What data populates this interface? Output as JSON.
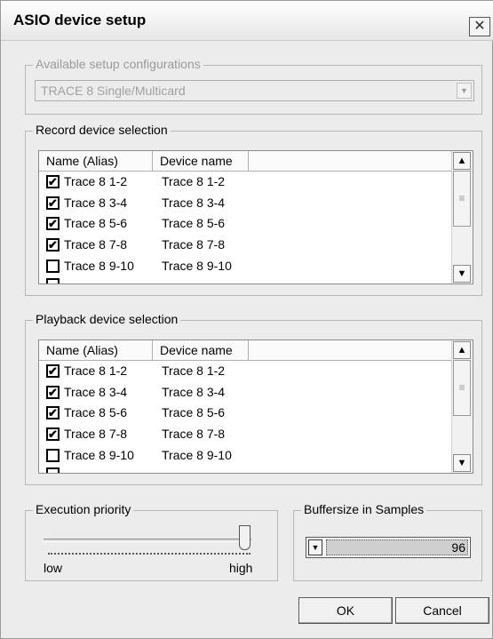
{
  "window": {
    "title": "ASIO device setup",
    "close_glyph": "✕"
  },
  "setup_configurations": {
    "legend": "Available setup configurations",
    "selected": "TRACE 8 Single/Multicard"
  },
  "record": {
    "legend": "Record device selection",
    "columns": [
      "Name (Alias)",
      "Device name"
    ],
    "rows": [
      {
        "alias": "Trace 8 1-2",
        "device": "Trace 8 1-2",
        "checked": true
      },
      {
        "alias": "Trace 8 3-4",
        "device": "Trace 8 3-4",
        "checked": true
      },
      {
        "alias": "Trace 8 5-6",
        "device": "Trace 8 5-6",
        "checked": true
      },
      {
        "alias": "Trace 8 7-8",
        "device": "Trace 8 7-8",
        "checked": true
      },
      {
        "alias": "Trace 8 9-10",
        "device": "Trace 8 9-10",
        "checked": false
      }
    ]
  },
  "playback": {
    "legend": "Playback device selection",
    "columns": [
      "Name (Alias)",
      "Device name"
    ],
    "rows": [
      {
        "alias": "Trace 8 1-2",
        "device": "Trace 8 1-2",
        "checked": true
      },
      {
        "alias": "Trace 8 3-4",
        "device": "Trace 8 3-4",
        "checked": true
      },
      {
        "alias": "Trace 8 5-6",
        "device": "Trace 8 5-6",
        "checked": true
      },
      {
        "alias": "Trace 8 7-8",
        "device": "Trace 8 7-8",
        "checked": true
      },
      {
        "alias": "Trace 8 9-10",
        "device": "Trace 8 9-10",
        "checked": false
      }
    ]
  },
  "priority": {
    "legend": "Execution priority",
    "low_label": "low",
    "high_label": "high",
    "level": 1.0
  },
  "buffer": {
    "legend": "Buffersize in Samples",
    "value": "96"
  },
  "buttons": {
    "ok": "OK",
    "cancel": "Cancel"
  },
  "icons": {
    "check": "✔",
    "scroll_up": "chevron-up-icon",
    "scroll_down": "chevron-down-icon",
    "dropdown": "triangle-down-icon"
  }
}
